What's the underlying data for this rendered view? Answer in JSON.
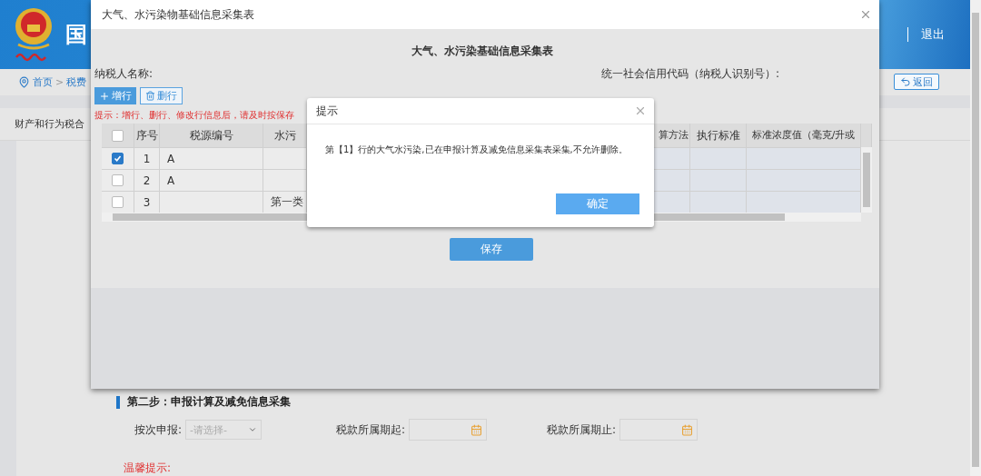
{
  "header": {
    "site_title": "国",
    "logout": "退出"
  },
  "breadcrumb": {
    "items": [
      "首页",
      "税费"
    ],
    "separator": ">"
  },
  "back_button": "返回",
  "nav_tab": "财产和行为税合",
  "step": {
    "title": "第二步：申报计算及减免信息采集",
    "fields": [
      {
        "kind": "select",
        "label": "按次申报:",
        "placeholder": "-请选择-"
      },
      {
        "kind": "date",
        "label": "税款所属期起:"
      },
      {
        "kind": "date",
        "label": "税款所属期止:"
      }
    ],
    "notice": "温馨提示:"
  },
  "modal": {
    "title": "大气、水污染物基础信息采集表",
    "heading": "大气、水污染基础信息采集表",
    "taxpayer_label": "纳税人名称:",
    "credit_code_label": "统一社会信用代码（纳税人识别号）:",
    "add_button": "增行",
    "delete_button": "删行",
    "hint": "提示：增行、删行、修改行信息后，请及时按保存",
    "table": {
      "header_checked": false,
      "columns": [
        "序号",
        "税源编号",
        "水污",
        "算方法",
        "执行标准",
        "标准浓度值（毫克/升或"
      ],
      "rows": [
        {
          "selected": true,
          "seq": "1",
          "code": "A"
        },
        {
          "selected": false,
          "seq": "2",
          "code": "A"
        },
        {
          "selected": false,
          "seq": "3",
          "pollutant": "第一类"
        }
      ]
    },
    "save_button": "保存"
  },
  "alert": {
    "title": "提示",
    "message": "第【1】行的大气水污染,已在申报计算及减免信息采集表采集,不允许删除。",
    "ok_button": "确定"
  }
}
